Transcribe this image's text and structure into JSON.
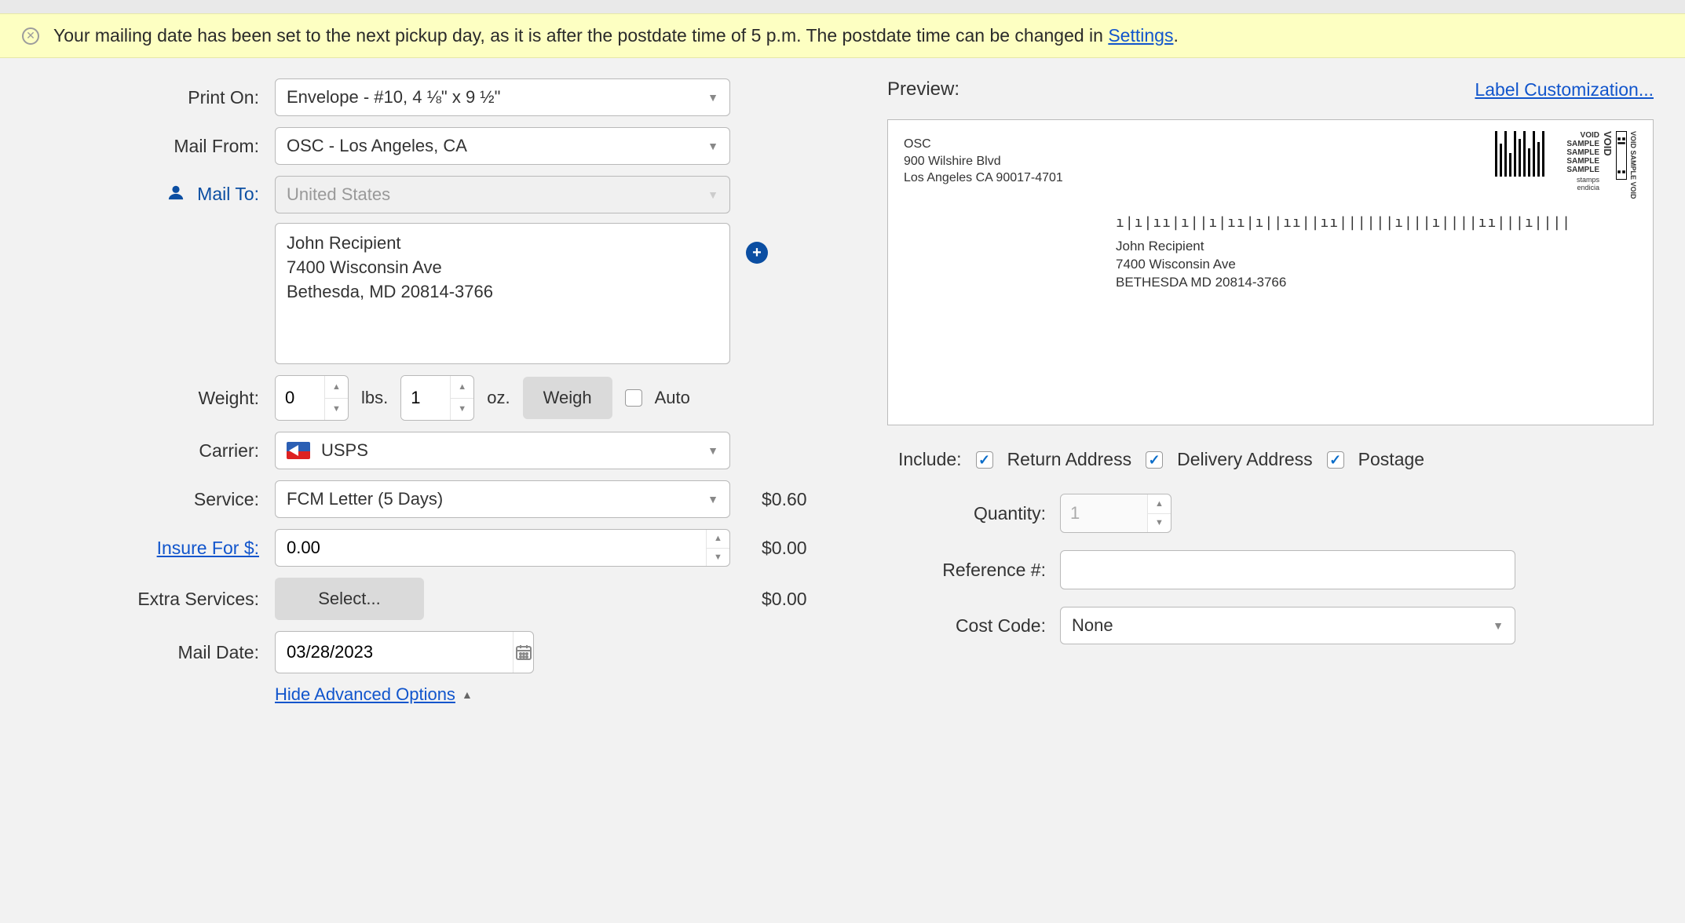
{
  "banner": {
    "message": "Your mailing date has been set to the next pickup day, as it is after the postdate time of 5 p.m. The postdate time can be changed in ",
    "settings_link": "Settings",
    "period": "."
  },
  "labels": {
    "print_on": "Print On:",
    "mail_from": "Mail From:",
    "mail_to": "Mail To:",
    "weight": "Weight:",
    "lbs": "lbs.",
    "oz": "oz.",
    "weigh_btn": "Weigh",
    "auto": "Auto",
    "carrier": "Carrier:",
    "service": "Service:",
    "insure_for": "Insure For $:",
    "extra_services": "Extra Services:",
    "select_btn": "Select...",
    "mail_date": "Mail Date:",
    "hide_adv": "Hide Advanced Options"
  },
  "form": {
    "print_on": "Envelope - #10, 4 ⅛\" x 9 ½\"",
    "mail_from": "OSC - Los Angeles, CA",
    "mail_to_country": "United States",
    "mail_to_address": "John Recipient\n7400 Wisconsin Ave\nBethesda, MD 20814-3766",
    "weight_lbs": "0",
    "weight_oz": "1",
    "auto_checked": false,
    "carrier": "USPS",
    "service": "FCM Letter (5 Days)",
    "service_price": "$0.60",
    "insure_value": "0.00",
    "insure_price": "$0.00",
    "extra_price": "$0.00",
    "mail_date": "03/28/2023"
  },
  "preview": {
    "title": "Preview:",
    "label_custom": "Label Customization...",
    "from_name": "OSC",
    "from_street": "900 Wilshire Blvd",
    "from_city": "Los Angeles CA 90017-4701",
    "to_name": "John Recipient",
    "to_street": "7400 Wisconsin Ave",
    "to_city": "BETHESDA MD 20814-3766",
    "void_text": "VOID",
    "sample_text": "SAMPLE",
    "brand": "stamps\nendicia"
  },
  "include": {
    "label": "Include:",
    "return_addr": "Return Address",
    "delivery_addr": "Delivery Address",
    "postage": "Postage"
  },
  "right_form": {
    "quantity_label": "Quantity:",
    "quantity": "1",
    "reference_label": "Reference #:",
    "reference": "",
    "costcode_label": "Cost Code:",
    "costcode": "None"
  }
}
